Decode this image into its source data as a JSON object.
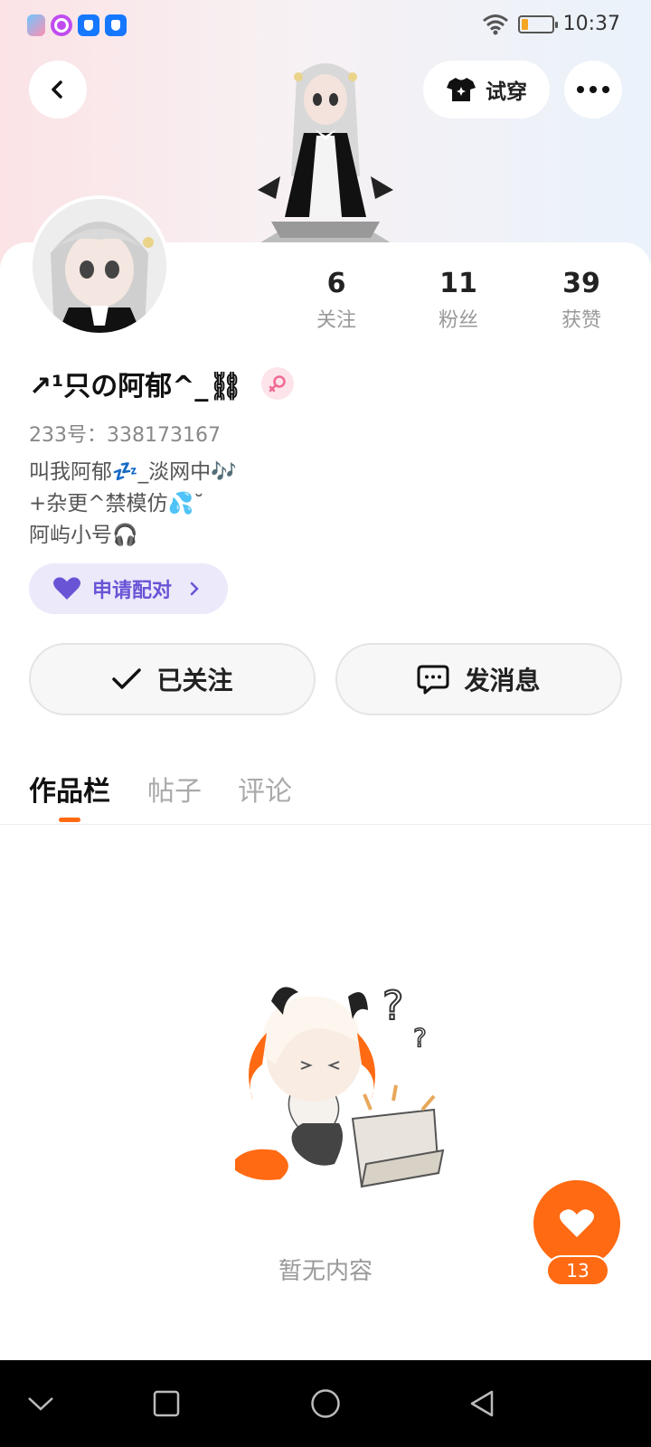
{
  "status_bar": {
    "time": "10:37"
  },
  "header": {
    "tryon_label": "试穿"
  },
  "profile": {
    "name": "↗¹只の阿郁^_⛓",
    "uid": "233号：338173167",
    "bio": [
      "叫我阿郁💤_淡网中🎶",
      "+杂更^禁模仿💦˘",
      "阿屿小号🎧"
    ],
    "stats": [
      {
        "num": "6",
        "label": "关注"
      },
      {
        "num": "11",
        "label": "粉丝"
      },
      {
        "num": "39",
        "label": "获赞"
      }
    ],
    "pair_label": "申请配对",
    "follow_label": "已关注",
    "message_label": "发消息"
  },
  "tabs": [
    {
      "label": "作品栏",
      "active": true
    },
    {
      "label": "帖子",
      "active": false
    },
    {
      "label": "评论",
      "active": false
    }
  ],
  "empty": {
    "text": "暂无内容"
  },
  "like": {
    "count": "13"
  },
  "colors": {
    "accent": "#ff6a13",
    "pair_text": "#6a54d6",
    "pair_bg": "#ece9fb"
  },
  "icons": [
    "back-icon",
    "shirt-icon",
    "more-icon",
    "female-icon",
    "heart-icon",
    "check-icon",
    "message-icon",
    "chevron-right-icon",
    "wifi-icon",
    "battery-icon"
  ]
}
